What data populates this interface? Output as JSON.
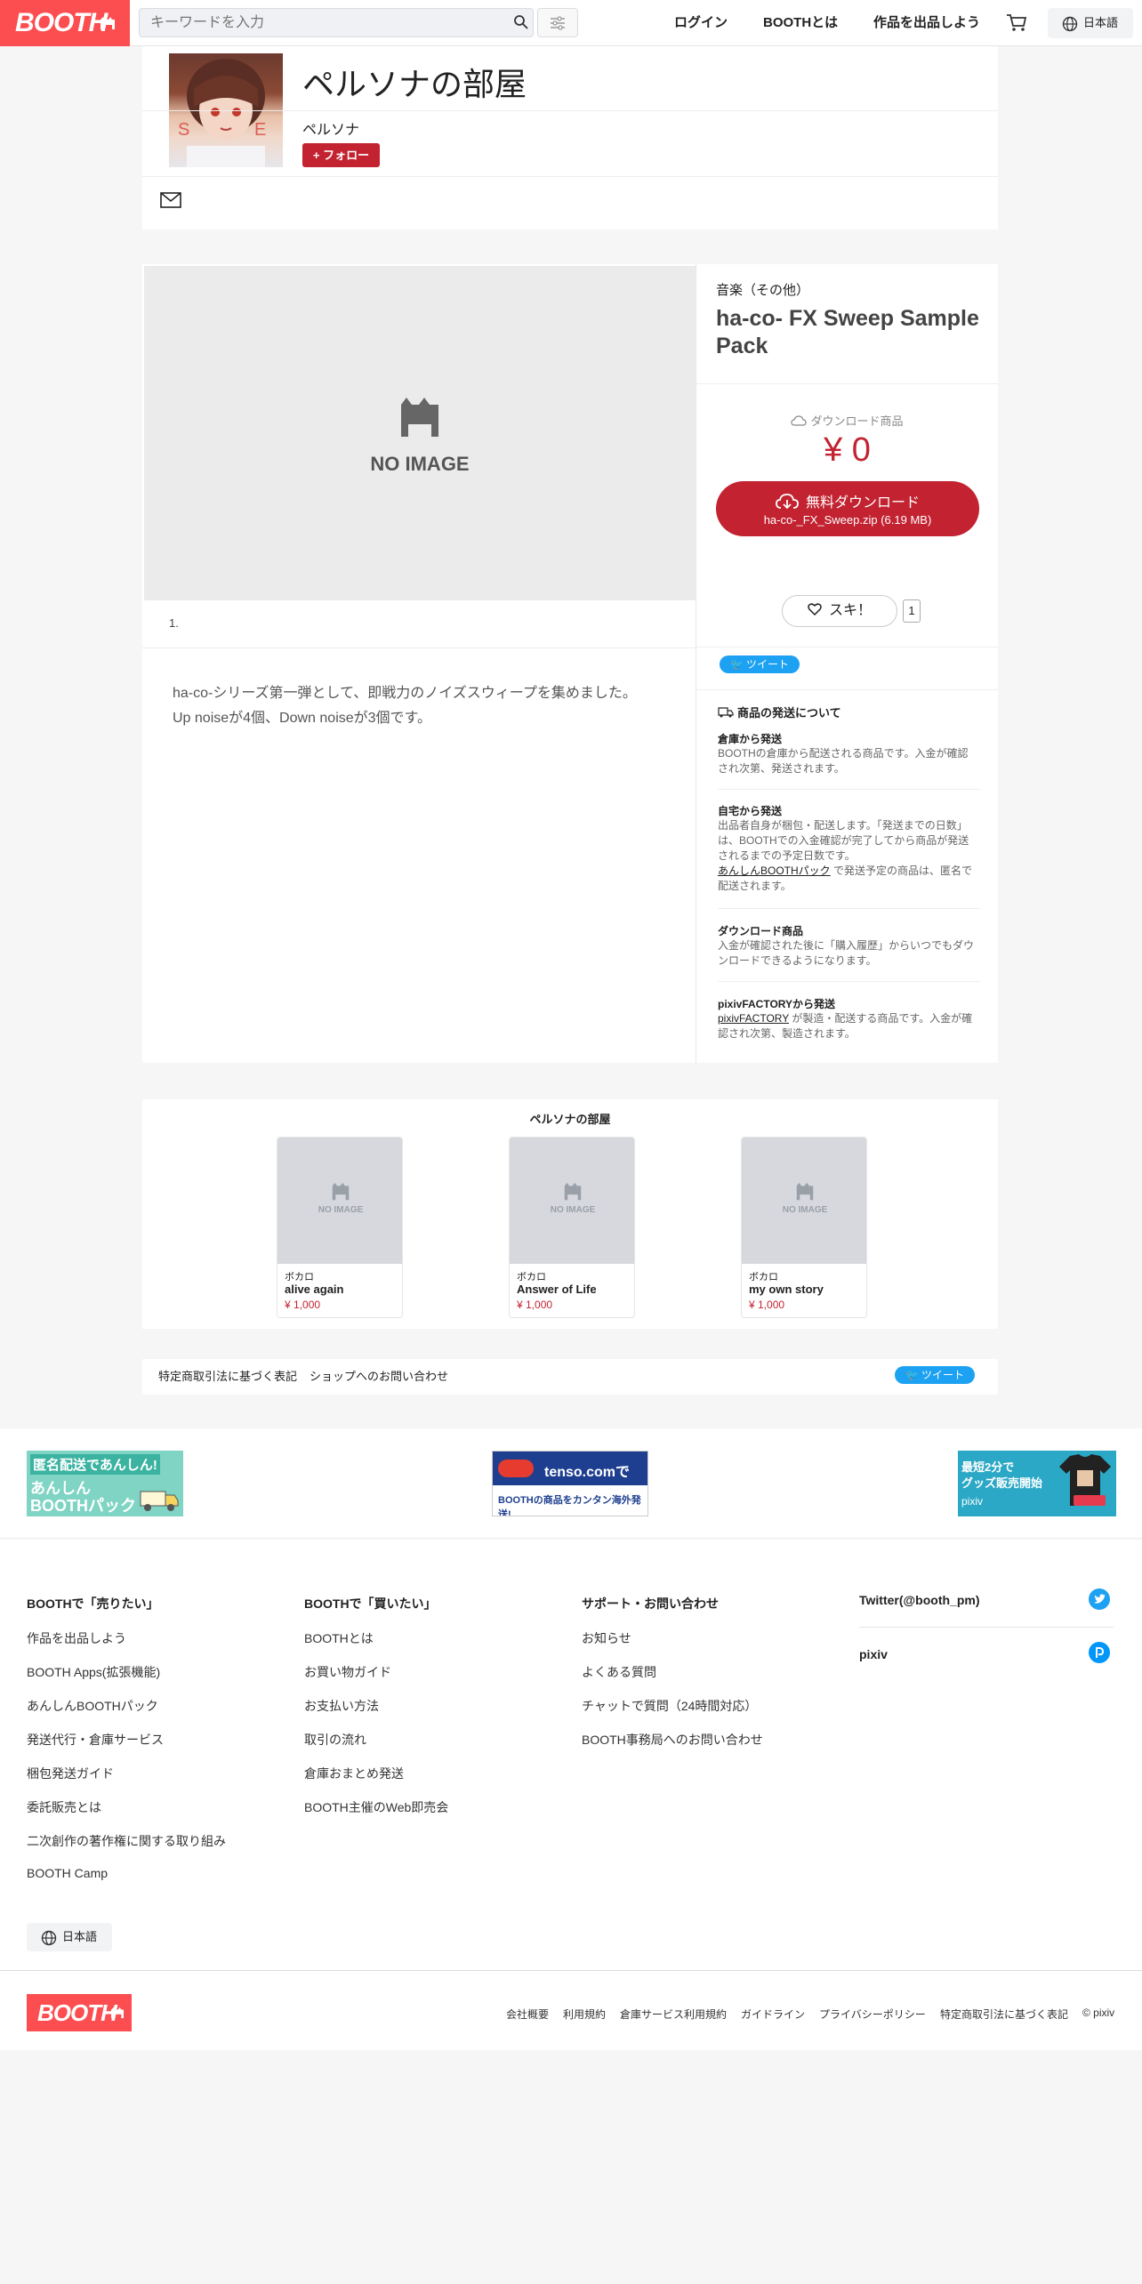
{
  "header": {
    "logo": "BOOTH",
    "search_placeholder": "キーワードを入力",
    "nav": {
      "login": "ログイン",
      "about": "BOOTHとは",
      "sell": "作品を出品しよう"
    },
    "language": "日本語"
  },
  "shop": {
    "name": "ペルソナの部屋",
    "owner": "ペルソナ",
    "follow_label": "+ フォロー"
  },
  "product": {
    "no_image": "NO IMAGE",
    "pager": "1.",
    "category": "音楽（その他）",
    "title": "ha-co- FX Sweep Sample Pack",
    "download_kind": "ダウンロード商品",
    "price": "¥ 0",
    "download_button": "無料ダウンロード",
    "download_file": "ha-co-_FX_Sweep.zip (6.19 MB)",
    "like_label": "スキ！",
    "like_count": "1",
    "tweet": "ツイート",
    "description": [
      "ha-co-シリーズ第一弾として、即戦力のノイズスウィープを集めました。",
      "Up noiseが4個、Down noiseが3個です。"
    ]
  },
  "shipping": {
    "heading": "商品の発送について",
    "items": [
      {
        "title": "倉庫から発送",
        "lines": [
          "BOOTHの倉庫から配送される商品です。入金が確認",
          "され次第、発送されます。"
        ]
      },
      {
        "title": "自宅から発送",
        "lines": [
          "出品者自身が梱包・配送します。「発送までの日数」",
          "は、BOOTHでの入金確認が完了してから商品が発送",
          "されるまでの予定日数です。"
        ],
        "link": "あんしんBOOTHパック",
        "link_rest": " で発送予定の商品は、匿名で",
        "last": "配送されます。"
      },
      {
        "title": "ダウンロード商品",
        "lines": [
          "入金が確認された後に「購入履歴」からいつでもダウ",
          "ンロードできるようになります。"
        ]
      },
      {
        "title": "pixivFACTORYから発送",
        "link": "pixivFACTORY",
        "link_rest": " が製造・配送する商品です。入金が確",
        "lines": [
          "認され次第、製造されます。"
        ]
      }
    ]
  },
  "related": {
    "title": "ペルソナの部屋",
    "items": [
      {
        "category": "ボカロ",
        "name": "alive again",
        "price": "¥ 1,000"
      },
      {
        "category": "ボカロ",
        "name": "Answer of Life",
        "price": "¥ 1,000"
      },
      {
        "category": "ボカロ",
        "name": "my own story",
        "price": "¥ 1,000"
      }
    ],
    "no_image": "NO IMAGE"
  },
  "shop_footer": {
    "law": "特定商取引法に基づく表記",
    "contact": "ショップへのお問い合わせ",
    "tweet": "ツイート"
  },
  "banners": {
    "anshin": {
      "line1": "匿名配送であんしん!",
      "line2": "あんしん",
      "line3": "BOOTHパック"
    },
    "tenso": {
      "brand": "tenso.comで",
      "sub": "BOOTHの商品をカンタン海外発送!"
    },
    "pixiv": {
      "line1": "最短2分で",
      "line2": "グッズ販売開始",
      "brand": "pixiv"
    }
  },
  "footer": {
    "col1": {
      "heading": "BOOTHで「売りたい」",
      "links": [
        "作品を出品しよう",
        "BOOTH Apps(拡張機能)",
        "あんしんBOOTHパック",
        "発送代行・倉庫サービス",
        "梱包発送ガイド",
        "委託販売とは",
        "二次創作の著作権に関する取り組み",
        "BOOTH Camp"
      ]
    },
    "col2": {
      "heading": "BOOTHで「買いたい」",
      "links": [
        "BOOTHとは",
        "お買い物ガイド",
        "お支払い方法",
        "取引の流れ",
        "倉庫おまとめ発送",
        "BOOTH主催のWeb即売会"
      ]
    },
    "col3": {
      "heading": "サポート・お問い合わせ",
      "links": [
        "お知らせ",
        "よくある質問",
        "チャットで質問（24時間対応）",
        "BOOTH事務局へのお問い合わせ"
      ]
    },
    "social": {
      "twitter": "Twitter(@booth_pm)",
      "pixiv": "pixiv"
    },
    "language": "日本語"
  },
  "bottom": {
    "logo": "BOOTH",
    "links": [
      "会社概要",
      "利用規約",
      "倉庫サービス利用規約",
      "ガイドライン",
      "プライバシーポリシー",
      "特定商取引法に基づく表記",
      "© pixiv"
    ]
  },
  "colors": {
    "brand": "#fc4d50",
    "accent": "#c32231",
    "twitter": "#1da1f2"
  }
}
